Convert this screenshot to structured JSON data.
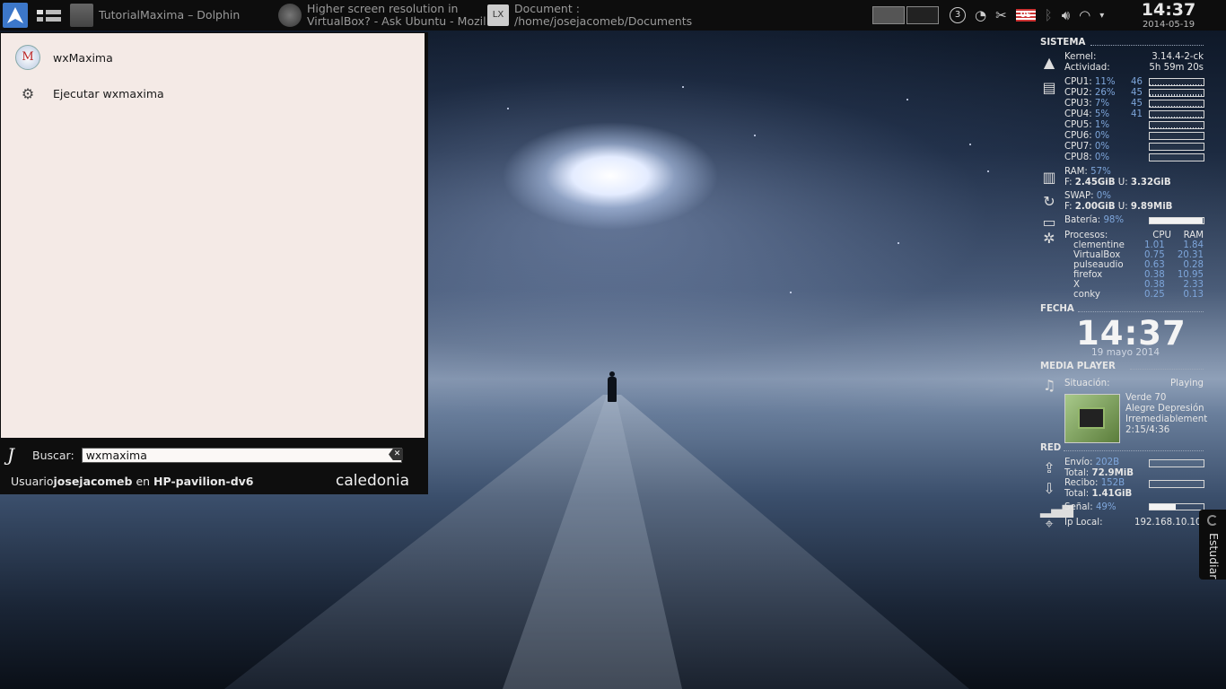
{
  "panel": {
    "tasks": [
      {
        "label": "TutorialMaxima – Dolphin"
      },
      {
        "label": "Higher screen resolution in\nVirtualBox? - Ask Ubuntu - Mozil"
      },
      {
        "label": "Document :\n/home/josejacomeb/Documents"
      }
    ],
    "tray": {
      "notifications_count": "3",
      "keyboard_layout": "US"
    },
    "clock": {
      "time": "14:37",
      "date": "2014-05-19"
    }
  },
  "launcher": {
    "results": [
      {
        "label": "wxMaxima",
        "icon": "wxmaxima-icon"
      },
      {
        "label": "Ejecutar wxmaxima",
        "icon": "run-gear-icon"
      }
    ],
    "search_label": "Buscar:",
    "search_value": "wxmaxima",
    "user_prefix": "Usuario",
    "user_name": "josejacomeb",
    "host_prefix": " en ",
    "host_name": "HP-pavilion-dv6",
    "brand": "caledonia"
  },
  "conky": {
    "sistema": {
      "title": "SISTEMA",
      "kernel_label": "Kernel:",
      "kernel_value": "3.14.4-2-ck",
      "uptime_label": "Actividad:",
      "uptime_value": "5h 59m 20s"
    },
    "cpus": [
      {
        "label": "CPU1:",
        "pct": "11%",
        "temp": "46",
        "level": 0.11
      },
      {
        "label": "CPU2:",
        "pct": "26%",
        "temp": "45",
        "level": 0.26
      },
      {
        "label": "CPU3:",
        "pct": "7%",
        "temp": "45",
        "level": 0.07
      },
      {
        "label": "CPU4:",
        "pct": "5%",
        "temp": "41",
        "level": 0.05
      },
      {
        "label": "CPU5:",
        "pct": "1%",
        "temp": "",
        "level": 0.01
      },
      {
        "label": "CPU6:",
        "pct": "0%",
        "temp": "",
        "level": 0
      },
      {
        "label": "CPU7:",
        "pct": "0%",
        "temp": "",
        "level": 0
      },
      {
        "label": "CPU8:",
        "pct": "0%",
        "temp": "",
        "level": 0
      }
    ],
    "ram": {
      "label": "RAM:",
      "pct": "57%",
      "free_label": "F:",
      "free": "2.45GiB",
      "used_label": "U:",
      "used": "3.32GiB"
    },
    "swap": {
      "label": "SWAP:",
      "pct": "0%",
      "free_label": "F:",
      "free": "2.00GiB",
      "used_label": "U:",
      "used": "9.89MiB"
    },
    "battery": {
      "label": "Batería:",
      "pct": "98%",
      "level": 0.98
    },
    "procs": {
      "label": "Procesos:",
      "cpu_header": "CPU",
      "ram_header": "RAM",
      "rows": [
        {
          "name": "clementine",
          "cpu": "1.01",
          "ram": "1.84"
        },
        {
          "name": "VirtualBox",
          "cpu": "0.75",
          "ram": "20.31"
        },
        {
          "name": "pulseaudio",
          "cpu": "0.63",
          "ram": "0.28"
        },
        {
          "name": "firefox",
          "cpu": "0.38",
          "ram": "10.95"
        },
        {
          "name": "X",
          "cpu": "0.38",
          "ram": "2.33"
        },
        {
          "name": "conky",
          "cpu": "0.25",
          "ram": "0.13"
        }
      ]
    },
    "fecha": {
      "title": "FECHA",
      "time": "14:37",
      "date": "19 mayo 2014"
    },
    "media": {
      "title": "MEDIA PLAYER",
      "status_label": "Situación:",
      "status": "Playing",
      "track": "Verde 70",
      "artist": "Alegre Depresión",
      "album": "Irremediablement",
      "position": "2:15/4:36"
    },
    "red": {
      "title": "RED",
      "up_label": "Envío:",
      "up_rate": "202B",
      "up_total_label": "Total:",
      "up_total": "72.9MiB",
      "down_label": "Recibo:",
      "down_rate": "152B",
      "down_total_label": "Total:",
      "down_total": "1.41GiB",
      "signal_label": "Señal:",
      "signal": "49%",
      "signal_level": 0.49,
      "ip_label": "Ip Local:",
      "ip": "192.168.10.101"
    }
  },
  "side_tab": {
    "label": "Estudiar"
  }
}
